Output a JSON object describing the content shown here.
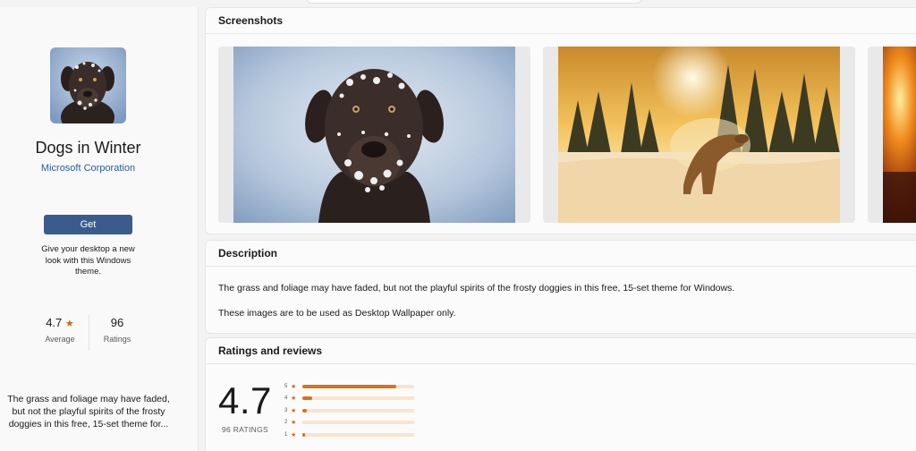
{
  "app": {
    "title": "Dogs in Winter",
    "publisher": "Microsoft Corporation",
    "get_label": "Get",
    "short_description": "Give your desktop a new look with this Windows theme.",
    "long_description_excerpt": "The grass and foliage may have faded, but not the playful spirits of the frosty doggies in this free, 15-set theme for...",
    "icon": "dog-in-snow-thumbnail"
  },
  "stats": {
    "rating_value": "4.7",
    "rating_label": "Average",
    "ratings_count": "96",
    "ratings_count_label": "Ratings"
  },
  "screenshots": {
    "heading": "Screenshots",
    "items": [
      "snowy-chocolate-lab-portrait",
      "dog-leaping-in-snow-at-sunset",
      "fireplace-glow-partial"
    ]
  },
  "description": {
    "heading": "Description",
    "paragraphs": [
      "The grass and foliage may have faded, but not the playful spirits of the frosty doggies in this free, 15-set theme for Windows.",
      "These images are to be used as Desktop Wallpaper only."
    ]
  },
  "ratings": {
    "heading": "Ratings and reviews",
    "average": "4.7",
    "count_label": "96 RATINGS",
    "distribution": [
      {
        "stars": "5",
        "fraction": 0.84
      },
      {
        "stars": "4",
        "fraction": 0.09
      },
      {
        "stars": "3",
        "fraction": 0.04
      },
      {
        "stars": "2",
        "fraction": 0.0
      },
      {
        "stars": "1",
        "fraction": 0.02
      }
    ]
  },
  "colors": {
    "accent": "#3a5b8d",
    "star": "#c96b18",
    "bar_fill": "#d3741e",
    "bar_track": "#fbe3cc",
    "link": "#2a5ba1"
  }
}
